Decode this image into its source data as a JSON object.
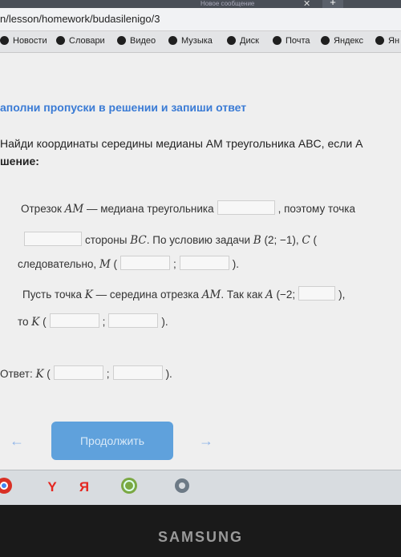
{
  "browser": {
    "tab_title": "Новое сообщение",
    "tab_close": "✕",
    "new_tab": "+",
    "url": "n/lesson/homework/budasilenigo/3"
  },
  "bookmarks": [
    {
      "label": "Новости"
    },
    {
      "label": "Словари"
    },
    {
      "label": "Видео"
    },
    {
      "label": "Музыка"
    },
    {
      "label": "Диск"
    },
    {
      "label": "Почта"
    },
    {
      "label": "Яндекс"
    },
    {
      "label": "Ян"
    }
  ],
  "lesson": {
    "heading": "аполни пропуски в решении и запиши ответ",
    "task": "Найди координаты середины медианы AM треугольника ABC, если A",
    "solution_label": "шение:",
    "line1_part1": "Отрезок ",
    "line1_var": "AM",
    "line1_part2": " — медиана треугольника",
    "line1_part3": ", поэтому точка",
    "line2_part1": "стороны ",
    "line2_var": "BC",
    "line2_part2": ". По условию задачи ",
    "line2_var2": "B",
    "line2_part3": " (2; −1), ",
    "line2_var3": "C",
    "line2_part4": " (",
    "line3_part1": "следовательно, ",
    "line3_var": "M",
    "line3_part2": " (",
    "line3_sep": ";",
    "line3_end": ").",
    "line4_part1": "Пусть точка ",
    "line4_var": "K",
    "line4_part2": " — середина отрезка ",
    "line4_var2": "AM",
    "line4_part3": ". Так как ",
    "line4_var3": "A",
    "line4_part4": " (−2;",
    "line4_end": "), ",
    "line5_part1": "то ",
    "line5_var": "K",
    "line5_part2": " (",
    "line5_sep": ";",
    "line5_end": ").",
    "answer_label": "Ответ: ",
    "answer_var": "K",
    "answer_open": " (",
    "answer_sep": ";",
    "answer_end": ")."
  },
  "navigation": {
    "prev_arrow": "←",
    "continue_label": "Продолжить",
    "next_arrow": "→"
  },
  "taskbar": {
    "icons": [
      "chrome-icon",
      "yandex-y-icon",
      "yandex-ya-icon",
      "globe-icon",
      "settings-icon"
    ],
    "yandex_y": "Y",
    "yandex_ya": "Я"
  },
  "device": {
    "brand": "SAMSUNG"
  },
  "colors": {
    "heading": "#3a7bd5",
    "button": "#5fa1dc",
    "arrow": "#8fb4e8"
  }
}
